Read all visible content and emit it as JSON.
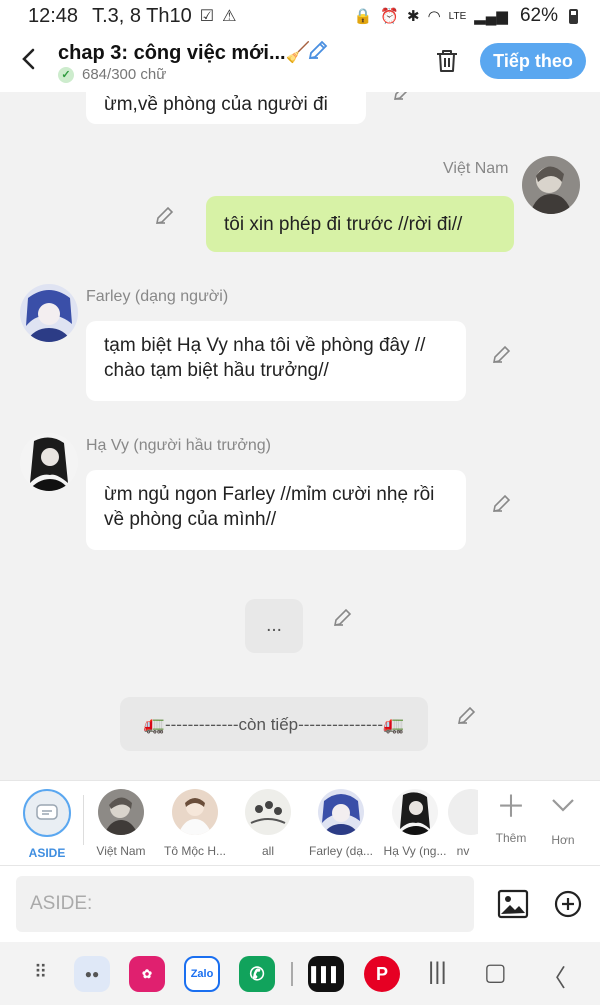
{
  "status_bar": {
    "time": "12:48",
    "date": "T.3, 8 Th10",
    "battery": "62%",
    "network": "LTE"
  },
  "header": {
    "title": "chap 3: công việc mới...🧹",
    "word_count": "684/300 chữ",
    "next_label": "Tiếp theo"
  },
  "messages": [
    {
      "text": "ừm,về phòng của người đi"
    },
    {
      "name": "Việt Nam",
      "text": "tôi xin phép đi trước //rời đi//"
    },
    {
      "name": "Farley (dạng người)",
      "text": "tạm biệt Hạ Vy nha tôi về phòng đây // chào tạm biệt hầu trưởng//"
    },
    {
      "name": "Hạ Vy (người hầu trưởng)",
      "text": "ừm ngủ ngon Farley //mỉm cười nhẹ rồi về phòng của mình//"
    },
    {
      "text": "..."
    },
    {
      "text": "🚛-------------còn tiếp---------------🚛"
    }
  ],
  "characters": [
    {
      "label": "ASIDE"
    },
    {
      "label": "Việt Nam"
    },
    {
      "label": "Tô Mộc H..."
    },
    {
      "label": "all"
    },
    {
      "label": "Farley (dạ..."
    },
    {
      "label": "Hạ Vy (ng..."
    },
    {
      "label": "nv"
    }
  ],
  "strip_actions": {
    "add": "Thêm",
    "more": "Hơn"
  },
  "input": {
    "placeholder": "ASIDE:"
  },
  "colors": {
    "accent": "#5aa7f0",
    "sent_bubble": "#d7f2a6",
    "background": "#f2f2f2"
  }
}
